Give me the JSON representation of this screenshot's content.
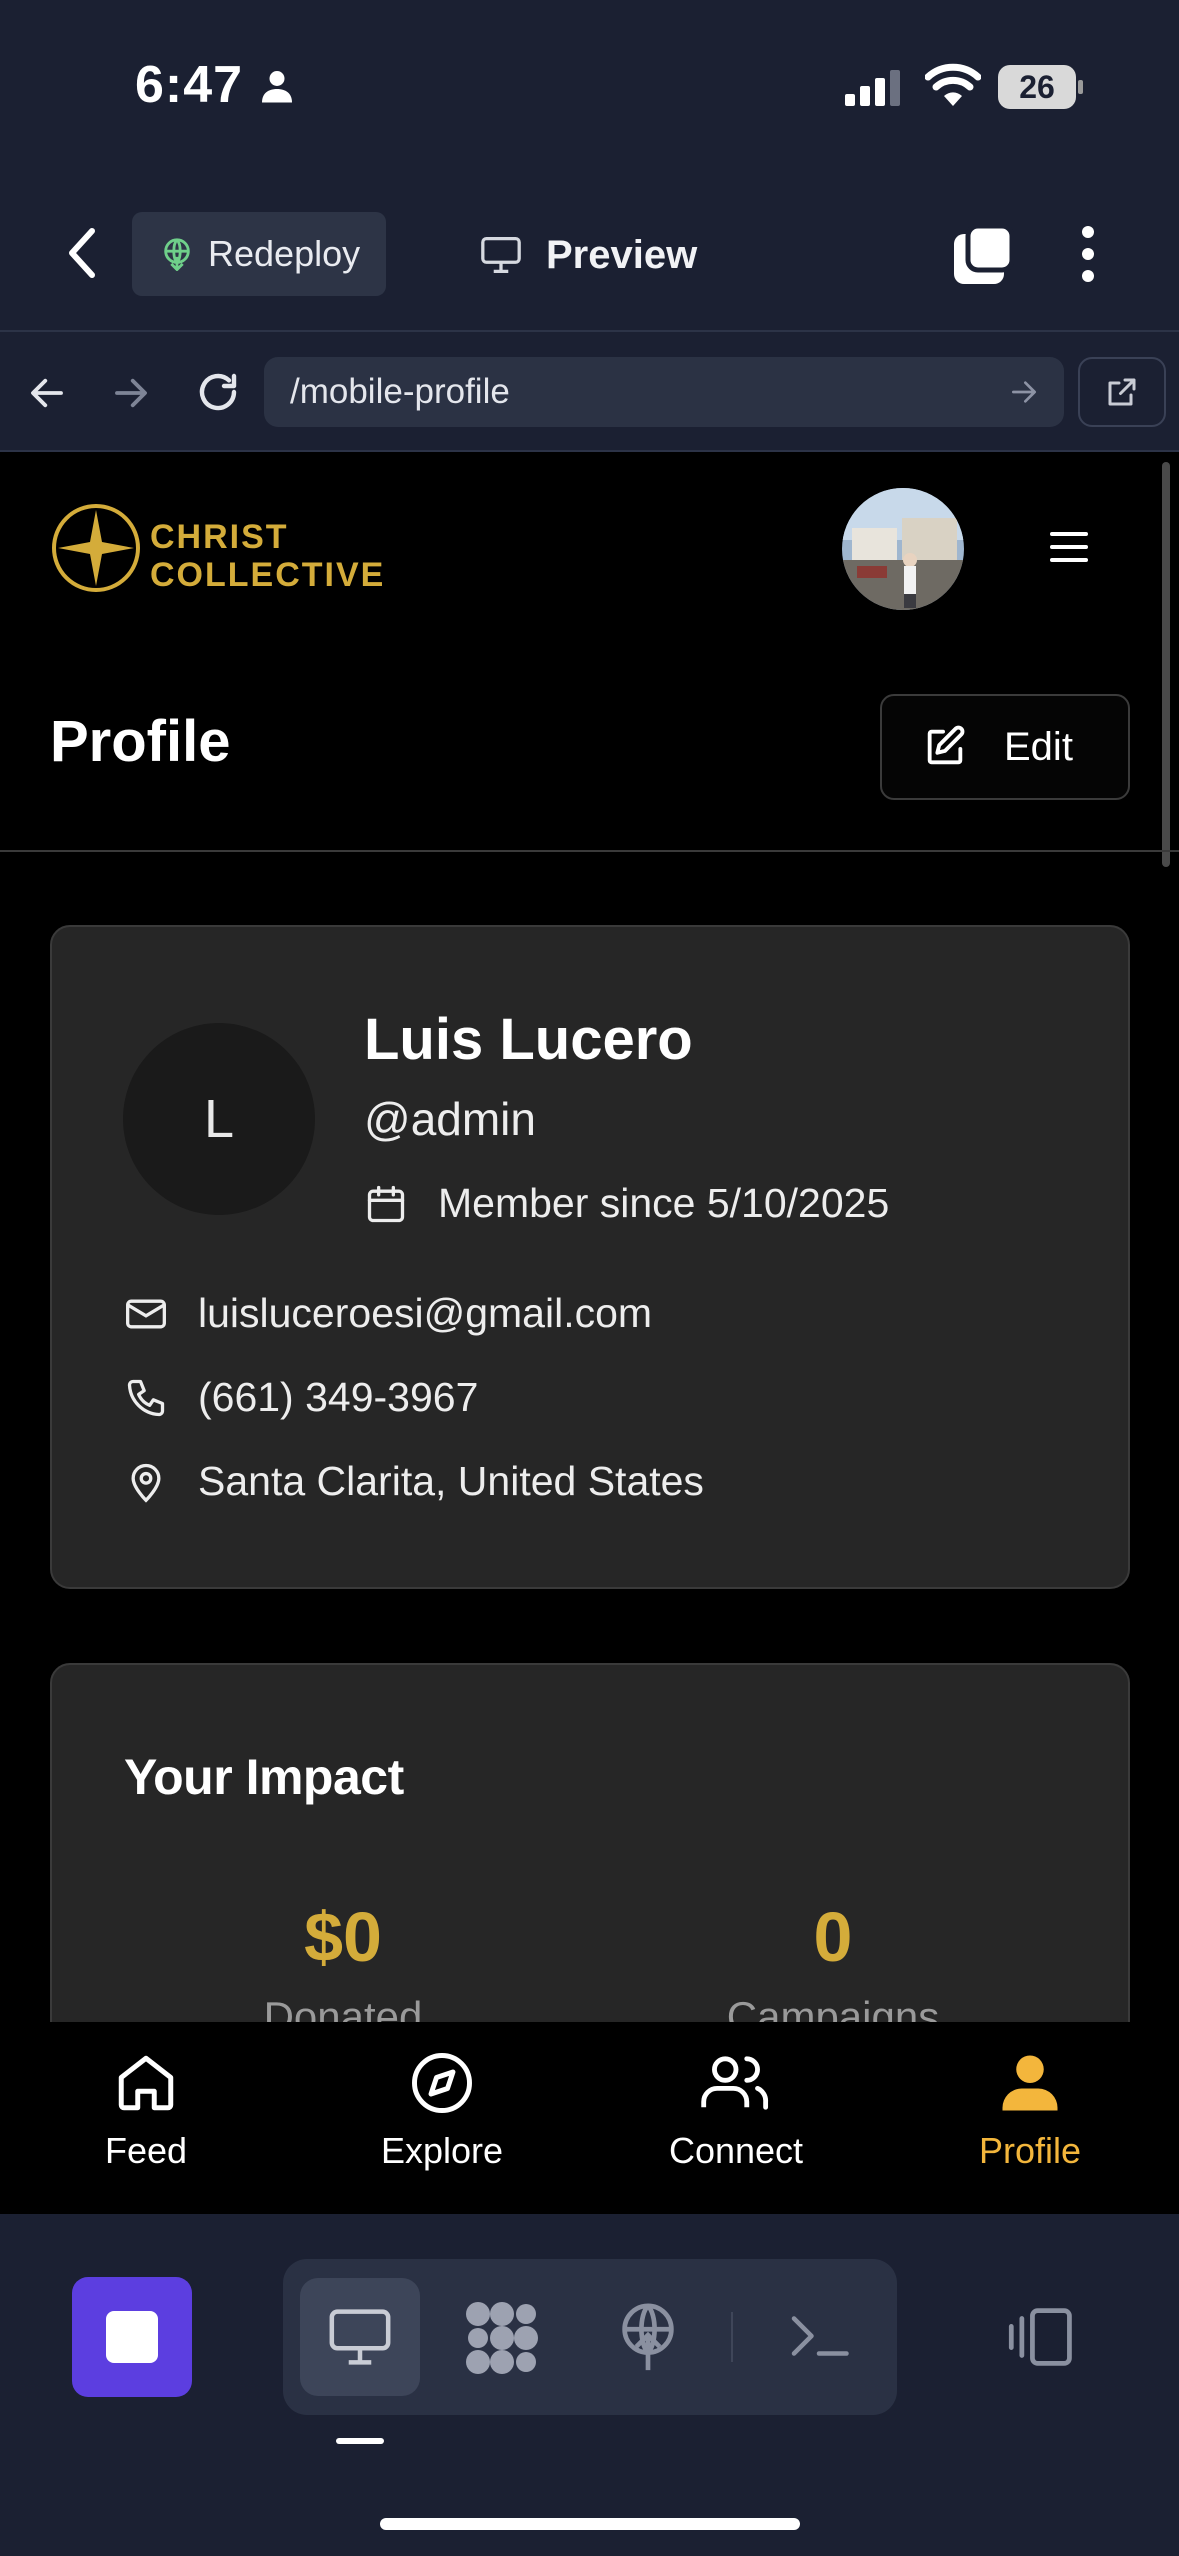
{
  "status_bar": {
    "time": "6:47",
    "battery": "26"
  },
  "replit_header": {
    "redeploy_label": "Redeploy",
    "preview_label": "Preview"
  },
  "browser": {
    "url": "/mobile-profile"
  },
  "app": {
    "brand": {
      "line1": "CHRIST",
      "line2": "COLLECTIVE"
    },
    "page_title": "Profile",
    "edit_label": "Edit",
    "profile": {
      "initial": "L",
      "name": "Luis Lucero",
      "handle": "@admin",
      "member_since": "Member since 5/10/2025",
      "email": "luisluceroesi@gmail.com",
      "phone": "(661) 349-3967",
      "location": "Santa Clarita, United States"
    },
    "impact": {
      "title": "Your Impact",
      "stats": [
        {
          "value": "$0",
          "label": "Donated"
        },
        {
          "value": "0",
          "label": "Campaigns"
        }
      ]
    },
    "tabs": [
      {
        "label": "Feed",
        "icon": "home-icon"
      },
      {
        "label": "Explore",
        "icon": "compass-icon"
      },
      {
        "label": "Connect",
        "icon": "users-icon"
      },
      {
        "label": "Profile",
        "icon": "user-icon",
        "active": true
      }
    ]
  },
  "colors": {
    "accent_gold": "#d4ac3a",
    "tab_active": "#f3b63c",
    "stop_purple": "#5c3ee0"
  }
}
